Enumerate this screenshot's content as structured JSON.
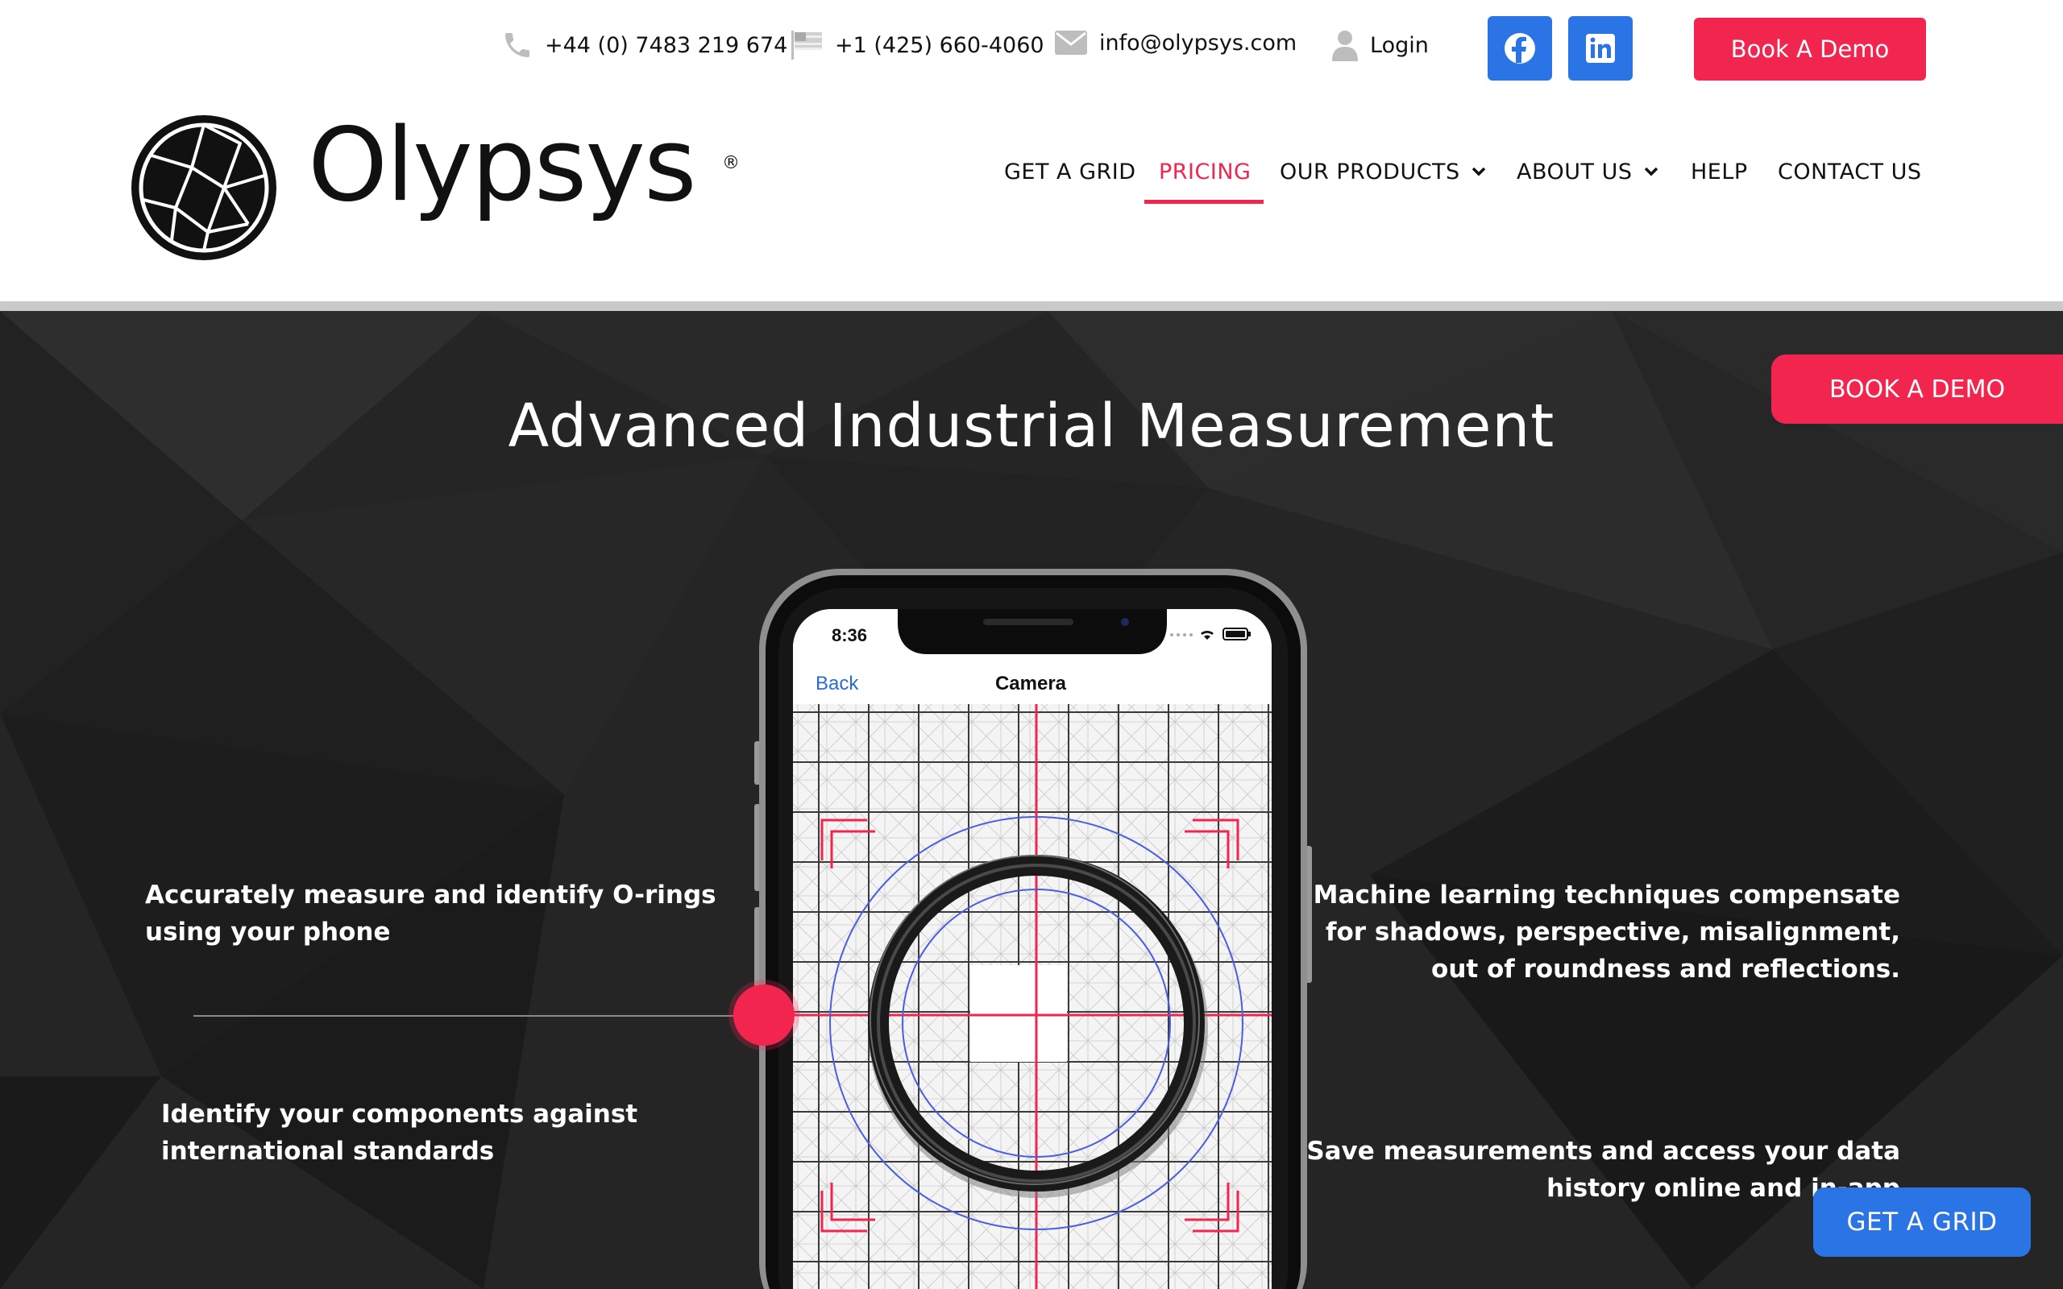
{
  "topbar": {
    "phone_uk": "+44 (0) 7483 219 674",
    "phone_us": "+1 (425) 660-4060",
    "email": "info@olypsys.com",
    "login": "Login",
    "book_demo": "Book A Demo",
    "social": [
      "facebook-icon",
      "linkedin-icon"
    ]
  },
  "brand": {
    "name": "Olypsys",
    "registered": "®"
  },
  "nav": {
    "items": [
      {
        "label": "GET A GRID"
      },
      {
        "label": "PRICING",
        "active": true
      },
      {
        "label": "OUR PRODUCTS",
        "has_dropdown": true
      },
      {
        "label": "ABOUT US",
        "has_dropdown": true
      },
      {
        "label": "HELP"
      },
      {
        "label": "CONTACT US"
      }
    ]
  },
  "hero": {
    "title": "Advanced Industrial Measurement",
    "book_demo": "BOOK A DEMO",
    "features": {
      "left_1": [
        "Accurately measure and identify O-rings",
        "using your phone"
      ],
      "left_2": [
        "Identify your components against",
        "international standards"
      ],
      "right_1": [
        "Machine learning techniques compensate",
        "for shadows, perspective, misalignment,",
        "out of roundness and reflections."
      ],
      "right_2": [
        "Save measurements and access your data",
        "history online and in-app"
      ]
    },
    "get_grid": "GET A GRID"
  },
  "phone_screen": {
    "time": "8:36",
    "back": "Back",
    "title": "Camera"
  },
  "colors": {
    "accent": "#f2254f",
    "blue": "#2b74e6",
    "hero_bg": "#252525"
  }
}
